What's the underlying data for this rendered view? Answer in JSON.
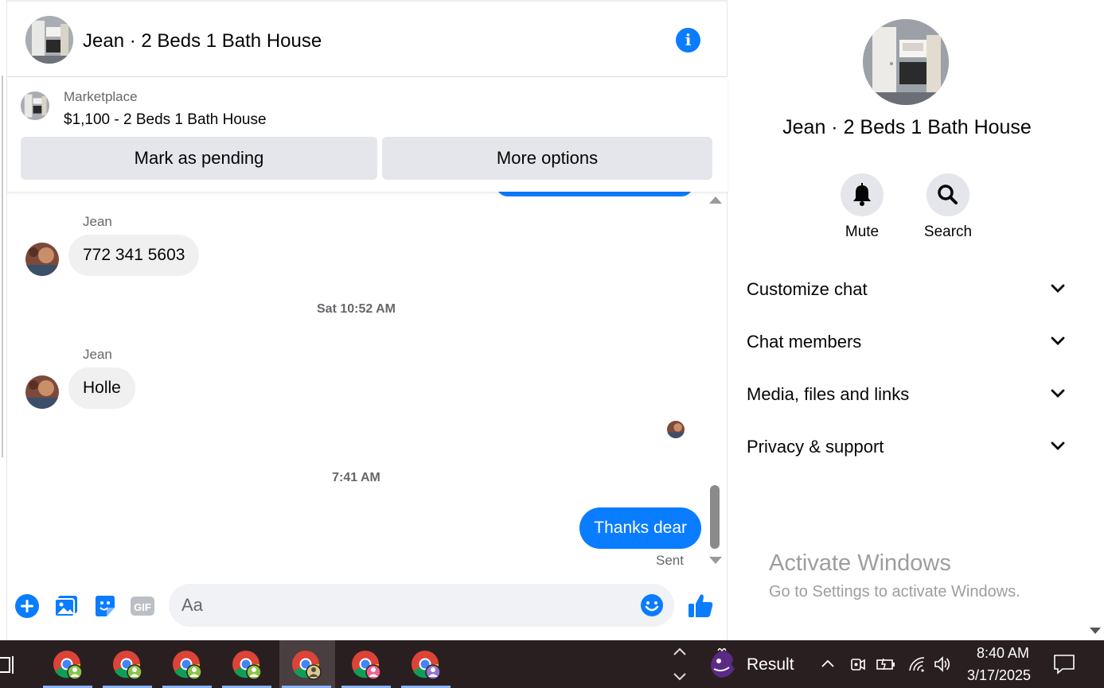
{
  "colors": {
    "accent": "#0a7cff",
    "bubble_in": "#f0f0f0",
    "button_bg": "#e4e6eb",
    "muted_text": "#65676b",
    "taskbar": "#2a1f20"
  },
  "chat": {
    "title": "Jean · 2 Beds 1 Bath House",
    "info_icon": "info-icon",
    "marketplace": {
      "label": "Marketplace",
      "item": "$1,100 - 2 Beds 1 Bath House",
      "mark_pending": "Mark as pending",
      "more_options": "More options"
    },
    "messages": [
      {
        "sender": "Jean",
        "text": "772  341 5603",
        "direction": "incoming"
      },
      {
        "timestamp": "Sat 10:52 AM"
      },
      {
        "sender": "Jean",
        "text": "Holle",
        "direction": "incoming"
      },
      {
        "timestamp": "7:41 AM"
      },
      {
        "text": "Thanks dear",
        "direction": "outgoing",
        "status": "Sent"
      }
    ],
    "composer": {
      "placeholder": "Aa",
      "icons": [
        "plus-icon",
        "photo-icon",
        "sticker-icon",
        "gif-icon",
        "emoji-icon",
        "like-icon"
      ],
      "gif_text": "GIF"
    }
  },
  "details": {
    "title": "Jean · 2 Beds 1 Bath House",
    "actions": [
      {
        "label": "Mute",
        "icon": "bell-icon"
      },
      {
        "label": "Search",
        "icon": "search-icon"
      }
    ],
    "sections": [
      {
        "label": "Customize chat"
      },
      {
        "label": "Chat members"
      },
      {
        "label": "Media, files and links"
      },
      {
        "label": "Privacy & support"
      }
    ],
    "watermark": {
      "title": "Activate Windows",
      "subtitle": "Go to Settings to activate Windows."
    }
  },
  "taskbar": {
    "apps": [
      {
        "icon": "chrome-icon",
        "profile": "green"
      },
      {
        "icon": "chrome-icon",
        "profile": "green"
      },
      {
        "icon": "chrome-icon",
        "profile": "green"
      },
      {
        "icon": "chrome-icon",
        "profile": "green"
      },
      {
        "icon": "chrome-icon",
        "profile": "green",
        "active": true
      },
      {
        "icon": "chrome-icon",
        "profile": "pink"
      },
      {
        "icon": "chrome-icon",
        "profile": "purple"
      }
    ],
    "widget_label": "Result",
    "time": "8:40 AM",
    "date": "3/17/2025"
  }
}
